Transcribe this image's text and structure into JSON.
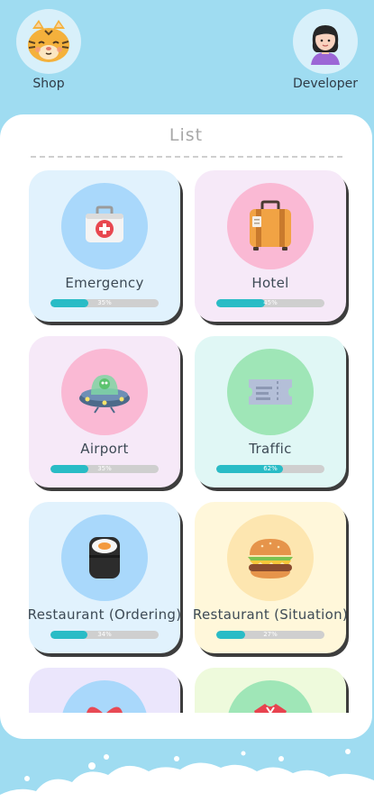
{
  "nav": {
    "shop_label": "Shop",
    "developer_label": "Developer"
  },
  "panel": {
    "title": "List"
  },
  "cards": [
    {
      "title": "Emergency",
      "progress": 0.35,
      "progress_label": "35%",
      "bg": "#e1f2fd",
      "icon_bg": "#a9d8fb",
      "icon": "first-aid-kit-icon"
    },
    {
      "title": "Hotel",
      "progress": 0.45,
      "progress_label": "45%",
      "bg": "#f6e9f8",
      "icon_bg": "#fab9d4",
      "icon": "suitcase-icon"
    },
    {
      "title": "Airport",
      "progress": 0.35,
      "progress_label": "35%",
      "bg": "#f6e9f8",
      "icon_bg": "#fab9d4",
      "icon": "ufo-icon"
    },
    {
      "title": "Traffic",
      "progress": 0.62,
      "progress_label": "62%",
      "bg": "#e0f7f5",
      "icon_bg": "#9fe6b7",
      "icon": "ticket-icon"
    },
    {
      "title": "Restaurant (Ordering)",
      "progress": 0.34,
      "progress_label": "34%",
      "bg": "#e1f2fd",
      "icon_bg": "#a9d8fb",
      "icon": "sushi-icon"
    },
    {
      "title": "Restaurant (Situation)",
      "progress": 0.27,
      "progress_label": "27%",
      "bg": "#fff7da",
      "icon_bg": "#fde6b0",
      "icon": "burger-icon"
    },
    {
      "title": "",
      "progress": 0,
      "progress_label": "",
      "bg": "#ebe6fc",
      "icon_bg": "#a9d8fb",
      "icon": "gift-icon"
    },
    {
      "title": "",
      "progress": 0,
      "progress_label": "",
      "bg": "#eefadc",
      "icon_bg": "#9fe6b7",
      "icon": "shirt-icon"
    }
  ]
}
